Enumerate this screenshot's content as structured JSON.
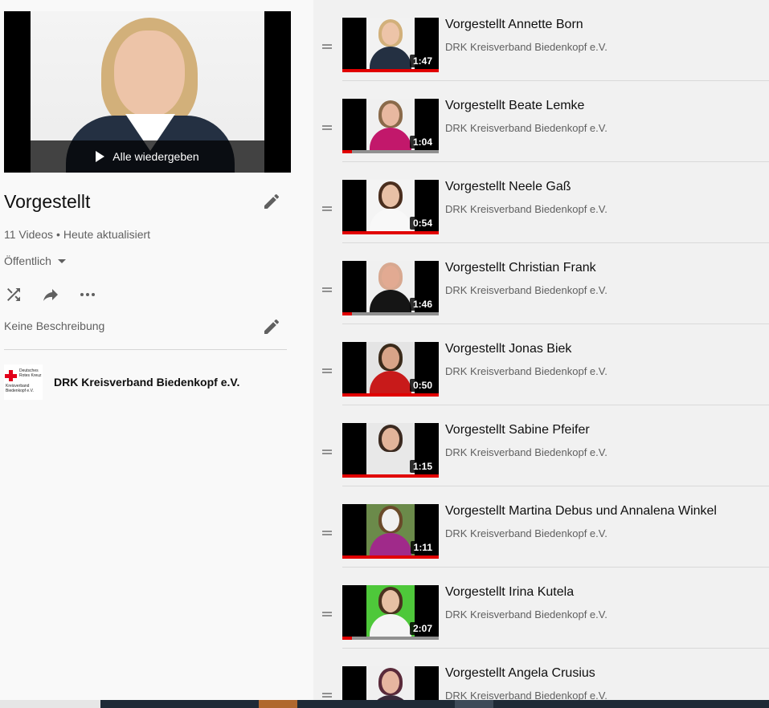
{
  "playlist": {
    "play_all_label": "Alle wiedergeben",
    "title": "Vorgestellt",
    "video_count": "11 Videos",
    "stats_separator": "•",
    "updated": "Heute aktualisiert",
    "privacy": "Öffentlich",
    "description": "Keine Beschreibung",
    "owner_name": "DRK Kreisverband Biedenkopf e.V.",
    "owner_logo_text_top": "Deutsches Rotes Kreuz",
    "owner_logo_text_bottom": "Kreisverband Biedenkopf e.V.",
    "colors": {
      "accent_red": "#e10000",
      "drk_red": "#e2001a"
    },
    "icons": [
      "pencil-icon",
      "shuffle-icon",
      "share-icon",
      "more-icon"
    ]
  },
  "videos": [
    {
      "title": "Vorgestellt Annette Born",
      "channel": "DRK Kreisverband Biedenkopf e.V.",
      "duration": "1:47",
      "progress": 1.0,
      "bg": "#f2f2f2",
      "hair": "#d2b07a",
      "skin": "#edc4a8",
      "shirt": "#243042"
    },
    {
      "title": "Vorgestellt Beate Lemke",
      "channel": "DRK Kreisverband Biedenkopf e.V.",
      "duration": "1:04",
      "progress": 0.1,
      "bg": "#f0f0f0",
      "hair": "#8a6a4a",
      "skin": "#e8b8a0",
      "shirt": "#c2186b"
    },
    {
      "title": "Vorgestellt Neele Gaß",
      "channel": "DRK Kreisverband Biedenkopf e.V.",
      "duration": "0:54",
      "progress": 1.0,
      "bg": "#f4f4f4",
      "hair": "#4a2e1e",
      "skin": "#e8c0a6",
      "shirt": "#f8f8f8"
    },
    {
      "title": "Vorgestellt Christian Frank",
      "channel": "DRK Kreisverband Biedenkopf e.V.",
      "duration": "1:46",
      "progress": 0.1,
      "bg": "#f0f0f0",
      "hair": "#d8a890",
      "skin": "#e2aa92",
      "shirt": "#151515"
    },
    {
      "title": "Vorgestellt Jonas Biek",
      "channel": "DRK Kreisverband Biedenkopf e.V.",
      "duration": "0:50",
      "progress": 1.0,
      "bg": "#e4e4e4",
      "hair": "#3a2a1a",
      "skin": "#d8a488",
      "shirt": "#c81a1a"
    },
    {
      "title": "Vorgestellt Sabine Pfeifer",
      "channel": "DRK Kreisverband Biedenkopf e.V.",
      "duration": "1:15",
      "progress": 1.0,
      "bg": "#e8e8e8",
      "hair": "#3b2a20",
      "skin": "#e2b49a",
      "shirt": "#e8e8e8"
    },
    {
      "title": "Vorgestellt Martina Debus und Annalena Winkel",
      "channel": "DRK Kreisverband Biedenkopf e.V.",
      "duration": "1:11",
      "progress": 1.0,
      "bg": "#6b8a4a",
      "hair": "#6a4a2a",
      "skin": "#f0f0f0",
      "shirt": "#a02a8a"
    },
    {
      "title": "Vorgestellt Irina Kutela",
      "channel": "DRK Kreisverband Biedenkopf e.V.",
      "duration": "2:07",
      "progress": 0.1,
      "bg": "#4ec83a",
      "hair": "#4a3220",
      "skin": "#e6c0a4",
      "shirt": "#f4f4f4"
    },
    {
      "title": "Vorgestellt Angela Crusius",
      "channel": "DRK Kreisverband Biedenkopf e.V.",
      "duration": "",
      "progress": 0.0,
      "bg": "#f0f0f0",
      "hair": "#5a2a3a",
      "skin": "#e6b6a0",
      "shirt": "#3a2a3a"
    }
  ]
}
